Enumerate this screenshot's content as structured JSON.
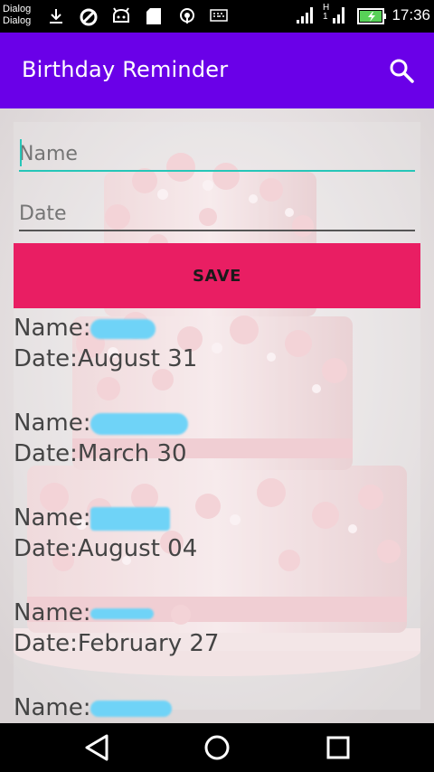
{
  "status_bar": {
    "notif_line1": "Dialog",
    "notif_line2": "Dialog",
    "time": "17:36"
  },
  "app_bar": {
    "title": "Birthday Reminder",
    "search_icon": "search-icon"
  },
  "form": {
    "name_placeholder": "Name",
    "date_placeholder": "Date",
    "save_label": "SAVE"
  },
  "entries": [
    {
      "name_label": "Name:",
      "date_text": "Date:August  31"
    },
    {
      "name_label": "Name:",
      "date_text": "Date:March  30"
    },
    {
      "name_label": "Name:",
      "date_text": "Date:August  04"
    },
    {
      "name_label": "Name:",
      "date_text": "Date:February  27"
    },
    {
      "name_label": "Name:"
    }
  ],
  "colors": {
    "app_bar": "#6a00e8",
    "save_button": "#e91e63",
    "accent": "#26c6b8"
  }
}
